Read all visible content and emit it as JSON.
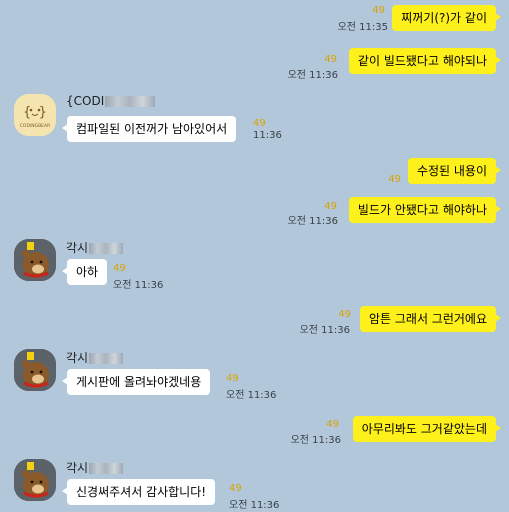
{
  "unread_count": "49",
  "messages": [
    {
      "side": "out",
      "text": "찌꺼기(?)가 같이",
      "time": "오전 11:35"
    },
    {
      "side": "out",
      "text": "같이 빌드됐다고 해야되나",
      "time": "오전 11:36"
    },
    {
      "side": "in",
      "sender": "{CODI",
      "avatar": "coding-bear-logo",
      "avatar_text": "CODINGBEAR",
      "text": "컴파일된 이전꺼가 남아있어서",
      "time": "11:36"
    },
    {
      "side": "out",
      "text": "수정된 내용이",
      "time": ""
    },
    {
      "side": "out",
      "text": "빌드가 안됐다고 해야하나",
      "time": "오전 11:36"
    },
    {
      "side": "in",
      "sender": "각시",
      "avatar": "brown-bear-icon",
      "text": "아하",
      "time": "오전 11:36"
    },
    {
      "side": "out",
      "text": "암튼 그래서 그런거에요",
      "time": "오전 11:36"
    },
    {
      "side": "in",
      "sender": "각시",
      "avatar": "brown-bear-icon",
      "text": "게시판에 올려놔야겠네용",
      "time": "오전 11:36"
    },
    {
      "side": "out",
      "text": "아무리봐도 그거같았는데",
      "time": "오전 11:36"
    },
    {
      "side": "in",
      "sender": "각시",
      "avatar": "brown-bear-icon",
      "text": "신경써주셔서 감사합니다!",
      "time": "오전 11:36"
    }
  ],
  "colors": {
    "background": "#b2c7d9",
    "outgoing_bubble": "#fef01b",
    "incoming_bubble": "#ffffff",
    "unread": "#d9a400"
  }
}
